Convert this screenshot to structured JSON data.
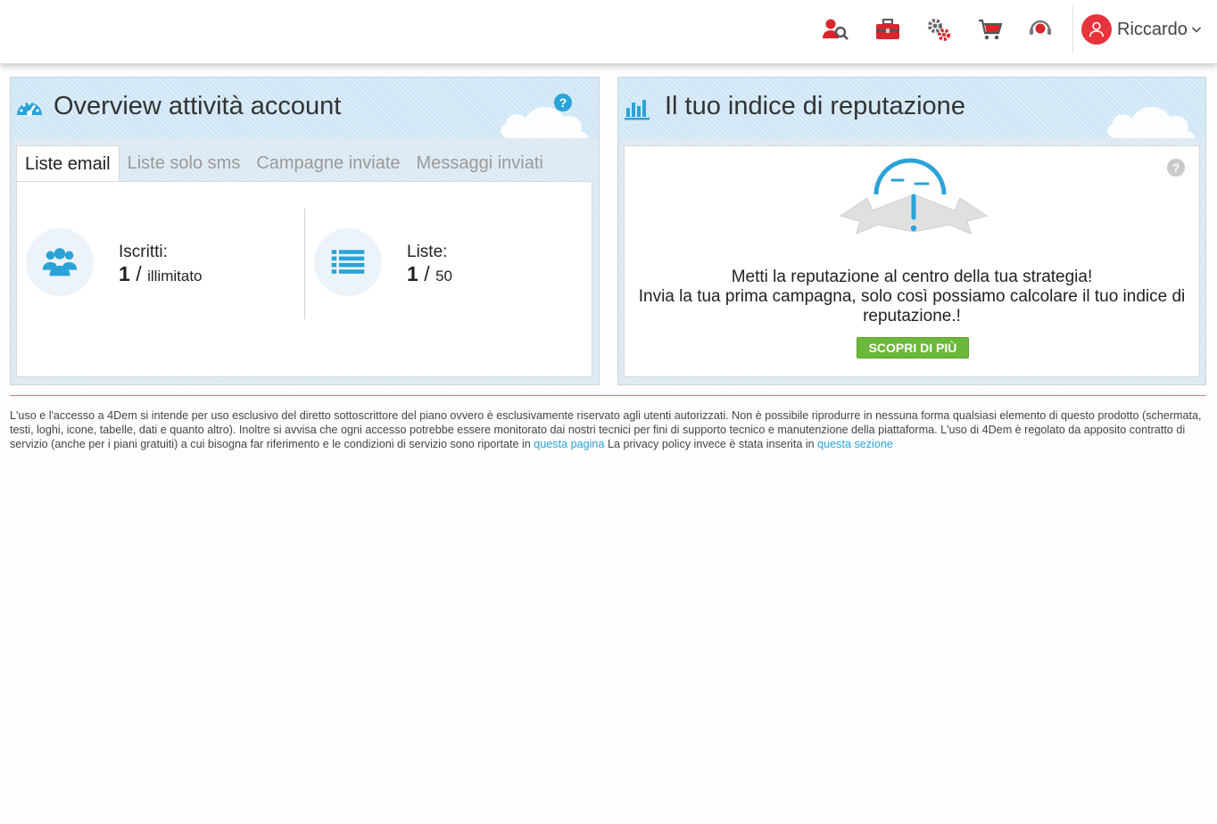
{
  "header": {
    "icons": [
      {
        "name": "user-search-icon",
        "color": "#d7262c"
      },
      {
        "name": "toolbox-icon",
        "color": "#d7262c"
      },
      {
        "name": "settings-gears-icon",
        "color": "#d7262c"
      },
      {
        "name": "shopping-cart-icon",
        "color": "#d7262c"
      },
      {
        "name": "support-headset-icon",
        "color": "#d7262c"
      }
    ],
    "user_name": "Riccardo",
    "accent": "#e8323c"
  },
  "overview": {
    "title": "Overview attività account",
    "help": "?",
    "tabs": [
      {
        "label": "Liste email",
        "active": true
      },
      {
        "label": "Liste solo sms",
        "active": false
      },
      {
        "label": "Campagne inviate",
        "active": false
      },
      {
        "label": "Messaggi inviati",
        "active": false
      }
    ],
    "stats": [
      {
        "icon": "users-icon",
        "label": "Iscritti:",
        "value": "1",
        "limit": "illimitato"
      },
      {
        "icon": "list-icon",
        "label": "Liste:",
        "value": "1",
        "limit": "50"
      }
    ],
    "slash": "/"
  },
  "reputation": {
    "title": "Il tuo indice di reputazione",
    "help": "?",
    "line1": "Metti la reputazione al centro della tua strategia!",
    "line2": "Invia la tua prima campagna, solo così possiamo calcolare il tuo indice di reputazione.!",
    "button": "SCOPRI DI PIÙ",
    "button_color": "#6cb83a"
  },
  "footer": {
    "text": "L'uso e l'accesso a 4Dem si intende per uso esclusivo del diretto sottoscrittore del piano ovvero è esclusivamente riservato agli utenti autorizzati. Non è possibile riprodurre in nessuna forma qualsiasi elemento di questo prodotto (schermata, testi, loghi, icone, tabelle, dati e quanto altro). Inoltre si avvisa che ogni accesso potrebbe essere monitorato dai nostri tecnici per fini di supporto tecnico e manutenzione della piattaforma. L'uso di 4Dem è regolato da apposito contratto di servizio (anche per i piani gratuiti) a cui bisogna far riferimento e le condizioni di servizio sono riportate in",
    "link1": "questa pagina",
    "middle": "La privacy policy invece è stata inserita in",
    "link2": "questa sezione",
    "link_color": "#2aa3d8"
  }
}
